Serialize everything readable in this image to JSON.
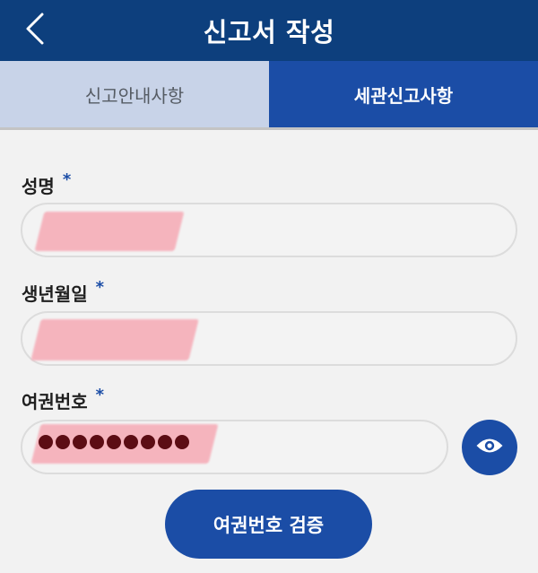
{
  "header": {
    "title": "신고서 작성"
  },
  "tabs": [
    {
      "label": "신고안내사항",
      "active": false
    },
    {
      "label": "세관신고사항",
      "active": true
    }
  ],
  "form": {
    "required_mark": "*",
    "name": {
      "label": "성명",
      "value": ""
    },
    "birthdate": {
      "label": "생년월일",
      "value": ""
    },
    "passport": {
      "label": "여권번호",
      "masked_value": "●●●●●●●●●"
    }
  },
  "verify_button": {
    "label": "여권번호 검증"
  },
  "icons": {
    "back": "chevron-left-icon",
    "visibility": "eye-icon"
  },
  "colors": {
    "header_bg": "#0d3f7d",
    "primary": "#1b4da6",
    "tab_inactive_bg": "#c8d3e8",
    "redaction": "#f6b1bb"
  }
}
